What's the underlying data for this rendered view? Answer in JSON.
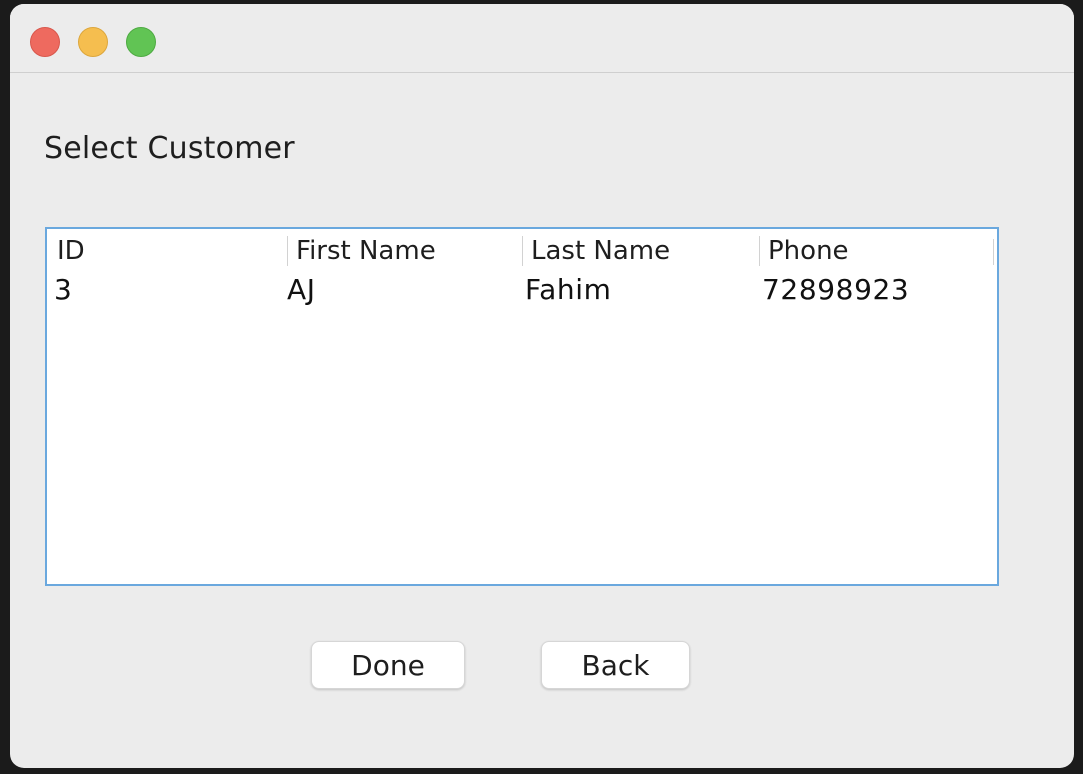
{
  "window": {
    "controls": [
      {
        "name": "close",
        "color": "#ee6a5f"
      },
      {
        "name": "minimize",
        "color": "#f5be4f"
      },
      {
        "name": "zoom",
        "color": "#61c454"
      }
    ]
  },
  "main": {
    "title": "Select Customer"
  },
  "table": {
    "columns": [
      "ID",
      "First Name",
      "Last Name",
      "Phone"
    ],
    "rows": [
      [
        "3",
        "AJ",
        "Fahim",
        "72898923"
      ]
    ],
    "border_color": "#6aa8de"
  },
  "buttons": {
    "done_label": "Done",
    "back_label": "Back"
  }
}
